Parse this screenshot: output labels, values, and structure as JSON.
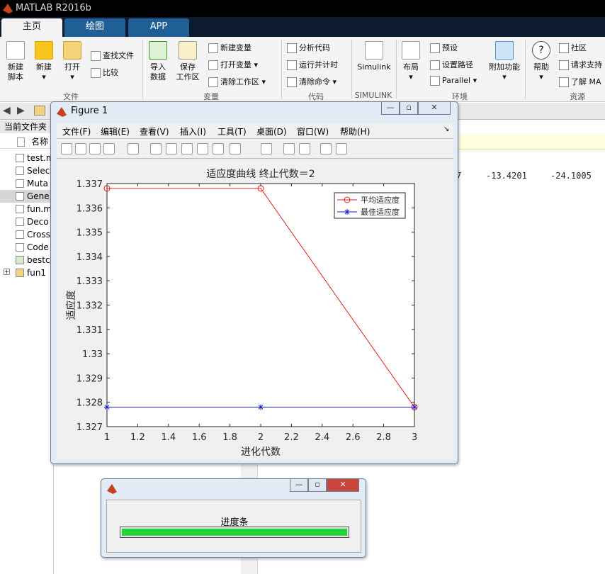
{
  "app": {
    "title": "MATLAB R2016b"
  },
  "tabs": [
    {
      "label": "主页"
    },
    {
      "label": "绘图"
    },
    {
      "label": "APP"
    }
  ],
  "ribbon": {
    "new_script": "新建\n脚本",
    "new": "新建",
    "open": "打开",
    "find_files": "查找文件",
    "compare": "比较",
    "import_data": "导入\n数据",
    "save_workspace": "保存\n工作区",
    "new_variable": "新建变量",
    "open_variable": "打开变量",
    "clear_workspace": "清除工作区",
    "analyze_code": "分析代码",
    "run_and_time": "运行并计时",
    "clear_commands": "清除命令",
    "simulink": "Simulink",
    "layout": "布局",
    "preferences": "预设",
    "set_path": "设置路径",
    "parallel": "Parallel",
    "addons": "附加功能",
    "help": "帮助",
    "community": "社区",
    "request_support": "请求支持",
    "learn_matlab": "了解 MA",
    "groups": {
      "file": "文件",
      "variable": "变量",
      "code": "代码",
      "simulink": "SIMULINK",
      "environment": "环境",
      "resources": "资源"
    }
  },
  "file_panel": {
    "title": "当前文件夹",
    "name_col": "名称",
    "files": [
      "test.m",
      "Selec",
      "Muta",
      "Gene",
      "fun.m",
      "Deco",
      "Cross",
      "Code",
      "bestc",
      "fun1"
    ]
  },
  "command_window": {
    "values": [
      "7",
      "-13.4201",
      "-24.1005"
    ]
  },
  "figure": {
    "title": "Figure 1",
    "menus": [
      "文件(F)",
      "编辑(E)",
      "查看(V)",
      "插入(I)",
      "工具(T)",
      "桌面(D)",
      "窗口(W)",
      "帮助(H)"
    ],
    "icons": [
      "new-figure-icon",
      "open-icon",
      "save-icon",
      "print-icon",
      "pointer-icon",
      "zoom-in-icon",
      "zoom-out-icon",
      "pan-icon",
      "rotate-icon",
      "data-cursor-icon",
      "brush-icon",
      "link-icon",
      "colorbar-icon",
      "legend-icon",
      "hide-tools-icon",
      "show-tools-icon"
    ]
  },
  "chart_data": {
    "type": "line",
    "title": "适应度曲线  终止代数＝2",
    "xlabel": "进化代数",
    "ylabel": "适应度",
    "xlim": [
      1,
      3
    ],
    "ylim": [
      1.327,
      1.337
    ],
    "xticks": [
      "1",
      "1.2",
      "1.4",
      "1.6",
      "1.8",
      "2",
      "2.2",
      "2.4",
      "2.6",
      "2.8",
      "3"
    ],
    "yticks": [
      "1.327",
      "1.328",
      "1.329",
      "1.33",
      "1.331",
      "1.332",
      "1.333",
      "1.334",
      "1.335",
      "1.336",
      "1.337"
    ],
    "legend_position": "top-right",
    "series": [
      {
        "name": "平均适应度",
        "x": [
          1,
          2,
          3
        ],
        "y": [
          1.3368,
          1.3368,
          1.3278
        ],
        "color": "#e02020",
        "marker": "circle"
      },
      {
        "name": "最佳适应度",
        "x": [
          1,
          2,
          3
        ],
        "y": [
          1.3278,
          1.3278,
          1.3278
        ],
        "color": "#1a1acc",
        "marker": "star"
      }
    ]
  },
  "progress": {
    "label": "进度条",
    "fraction": 1.0,
    "color": "#23d33b"
  }
}
